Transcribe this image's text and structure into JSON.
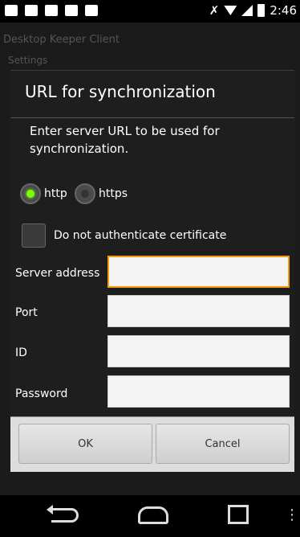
{
  "status_bar": {
    "time": "2:46",
    "icons": [
      "notification-icon",
      "cloud-upload-icon",
      "gmail-icon",
      "sim-icon",
      "photo-icon",
      "no-sound-icon",
      "wifi-icon",
      "signal-icon",
      "battery-icon"
    ]
  },
  "background_app": {
    "title": "Desktop Keeper Client",
    "settings_label": "Settings"
  },
  "dialog": {
    "title": "URL for synchronization",
    "message": "Enter server URL to be used for synchronization.",
    "protocol": {
      "options": [
        "http",
        "https"
      ],
      "selected": "http"
    },
    "checkbox": {
      "label": "Do not authenticate certificate",
      "checked": false
    },
    "fields": [
      {
        "label": "Server address",
        "value": "",
        "focused": true
      },
      {
        "label": "Port",
        "value": "",
        "focused": false
      },
      {
        "label": "ID",
        "value": "",
        "focused": false
      },
      {
        "label": "Password",
        "value": "",
        "focused": false
      }
    ],
    "buttons": {
      "ok": "OK",
      "cancel": "Cancel"
    }
  },
  "colors": {
    "radio_active": "#7CFC00",
    "focus_border": "#f39c12"
  }
}
